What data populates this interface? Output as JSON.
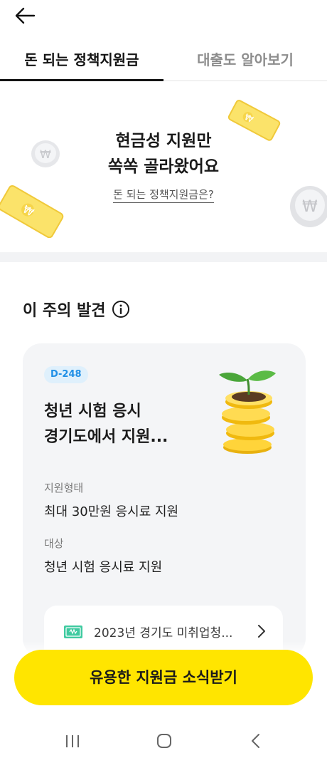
{
  "header": {
    "back_icon": "back-arrow-icon"
  },
  "tabs": [
    {
      "label": "돈 되는 정책지원금",
      "active": true
    },
    {
      "label": "대출도 알아보기",
      "active": false
    }
  ],
  "hero": {
    "title_line1": "현금성 지원만",
    "title_line2": "쏙쏙 골라왔어요",
    "link": "돈 되는 정책지원금은?"
  },
  "section": {
    "title": "이 주의 발견",
    "icon": "info-icon"
  },
  "card": {
    "dday": "D-248",
    "title_line1": "청년 시험 응시",
    "title_line2": "경기도에서 지원...",
    "fields": [
      {
        "label": "지원형태",
        "value": "최대 30만원 응시료 지원"
      },
      {
        "label": "대상",
        "value": "청년 시험 응시료 지원"
      }
    ]
  },
  "program": {
    "text": "2023년 경기도 미취업청...",
    "icon": "money-bill-icon"
  },
  "cta": {
    "label": "유용한 지원금 소식받기"
  },
  "navbar": {
    "recent_icon": "recent-apps-icon",
    "home_icon": "home-icon",
    "back_icon": "nav-back-icon"
  },
  "colors": {
    "accent": "#ffe500",
    "badge_bg": "#dff0fc",
    "badge_text": "#1f8fe6",
    "card_bg": "#f4f5f7"
  }
}
